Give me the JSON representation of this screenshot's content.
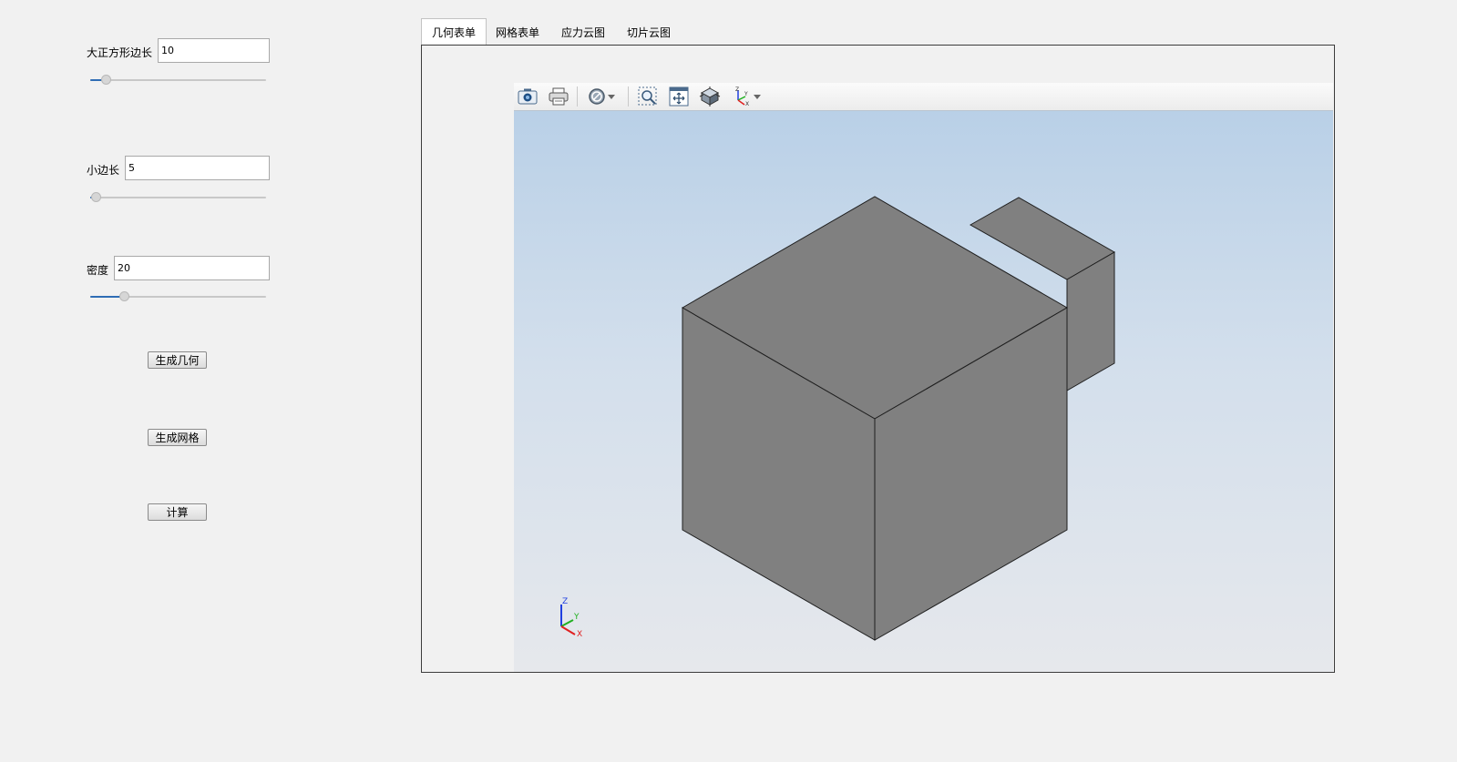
{
  "controls": {
    "big_side": {
      "label": "大正方形边长",
      "value": "10",
      "slider_fraction": 0.09
    },
    "small_side": {
      "label": "小边长",
      "value": "5",
      "slider_fraction": 0.03
    },
    "density": {
      "label": "密度",
      "value": "20",
      "slider_fraction": 0.19
    }
  },
  "buttons": {
    "generate_geometry": "生成几何",
    "generate_mesh": "生成网格",
    "compute": "计算"
  },
  "tabs": [
    {
      "label": "几何表单",
      "active": true
    },
    {
      "label": "网格表单",
      "active": false
    },
    {
      "label": "应力云图",
      "active": false
    },
    {
      "label": "切片云图",
      "active": false
    }
  ],
  "viewer": {
    "toolbar": [
      "camera-icon",
      "print-icon",
      "render-mode-icon",
      "zoom-box-icon",
      "fit-all-icon",
      "iso-view-icon",
      "axes-view-icon"
    ],
    "axis_labels": {
      "x": "X",
      "y": "Y",
      "z": "Z"
    },
    "colors": {
      "face": "#808080",
      "edge": "#1e1e1e",
      "axis_x": "#e02020",
      "axis_y": "#20b020",
      "axis_z": "#2040e0",
      "slider_fill": "#2f6db5"
    }
  }
}
